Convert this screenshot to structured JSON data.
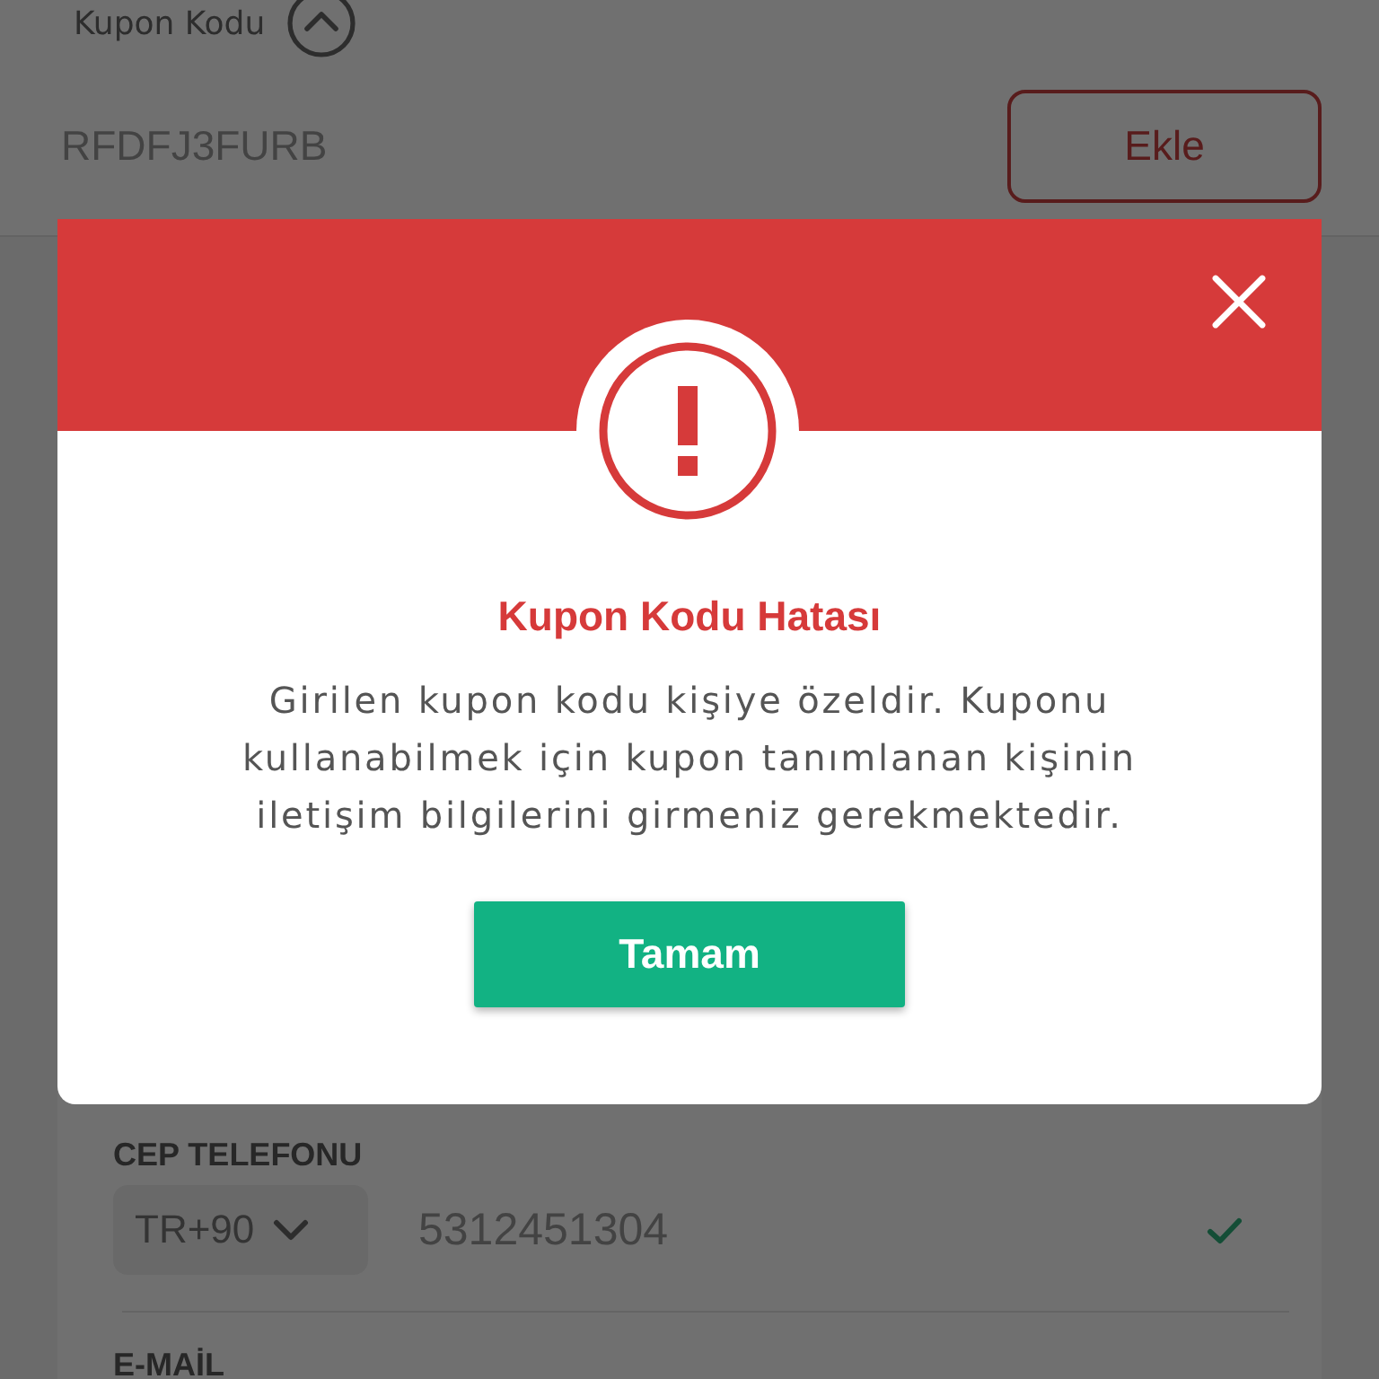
{
  "coupon": {
    "label": "Kupon Kodu",
    "expanded": true,
    "value": "RFDFJ3FURB",
    "add_button": "Ekle"
  },
  "contact": {
    "phone_label": "CEP TELEFONU",
    "country_code": "TR+90",
    "phone": "5312451304",
    "phone_valid": true,
    "email_label": "E-MAİL"
  },
  "dialog": {
    "title": "Kupon Kodu Hatası",
    "message": "Girilen kupon kodu kişiye özeldir. Kuponu kullanabilmek için kupon tanımlanan kişinin iletişim bilgilerini girmeniz gerekmektedir.",
    "button": "Tamam"
  }
}
